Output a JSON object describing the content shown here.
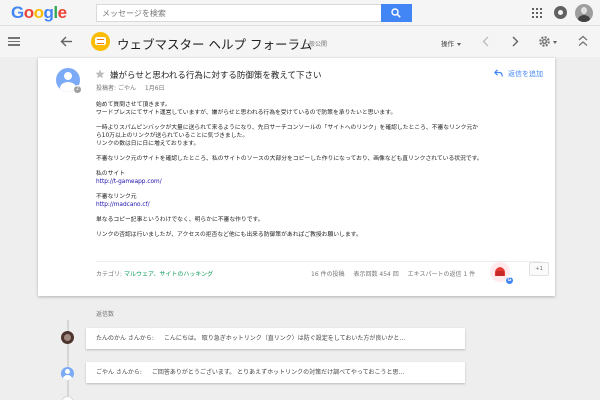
{
  "header": {
    "logo_letters": [
      {
        "ch": "G",
        "color": "#4285f4"
      },
      {
        "ch": "o",
        "color": "#ea4335"
      },
      {
        "ch": "o",
        "color": "#fbbc05"
      },
      {
        "ch": "g",
        "color": "#4285f4"
      },
      {
        "ch": "l",
        "color": "#34a853"
      },
      {
        "ch": "e",
        "color": "#ea4335"
      }
    ],
    "search_placeholder": "メッセージを検索"
  },
  "nav": {
    "forum_title": "ウェブマスター ヘルプ フォーラム",
    "forum_visibility": "一般公開",
    "actions_label": "操作"
  },
  "post": {
    "title": "嫌がらせと思われる行為に対する防御策を教えて下さい",
    "poster_label": "投稿者:",
    "author": "ごやん",
    "date": "1月6日",
    "reply_label": "返信を追加",
    "avatar_badge": "2",
    "body": {
      "p1_l1": "始めて質問させて頂きます。",
      "p1_l2": "ワードプレスにてサイト運営していますが、嫌がらせと思われる行為を受けているので防策を承りたいと思います。",
      "p2_l1": "一時よりスパムピンバックが大量に送られて来るようになり、先日サーチコンソールの「サイトへのリンク」を確認したところ、不審なリンク元か",
      "p2_l2": "ら10万以上のリンクが送られていることに気づきました。",
      "p2_l3": "リンクの数は日に日に増えております。",
      "p3": "不審なリンク元のサイトを確認したところ、私のサイトのソースの大部分をコピーした作りになっており、画像なども直リンクされている状況です。",
      "my_site_label": "私のサイト",
      "my_site_url": "http://t-gameapp.com/",
      "suspicious_label": "不審なリンク元",
      "suspicious_url": "http://madcano.cf/",
      "p4": "単なるコピー記事というわけでなく、明らかに不審な作りです。",
      "p5": "リンクの否認は行いましたが、アクセスの拒否など他にも出来る防御策があればご教授お願いします。"
    },
    "category_label": "カテゴリ:",
    "categories": "マルウェア、サイトのハッキング",
    "stats": {
      "posts": "16 件の投稿",
      "views": "表示回数 454 回",
      "expert_replies": "エキスパートの返信 1 件"
    },
    "expert_badge": "G",
    "plus_one": "+1"
  },
  "replies": {
    "label": "返信数",
    "items": [
      {
        "author": "たんのかん さんから:",
        "snippet": "こんにちは。 取り急ぎホットリンク（直リンク）は防ぐ設定をしておいた方が良いかと..."
      },
      {
        "author": "ごやん さんから:",
        "snippet": "ご回答ありがとうございます。 とりあえずホットリンクの対策だけ調べてやっておこうと思..."
      }
    ]
  },
  "colors": {
    "accent": "#4285f4",
    "category_link": "#0f9d58",
    "url_link": "#1a0dab"
  }
}
